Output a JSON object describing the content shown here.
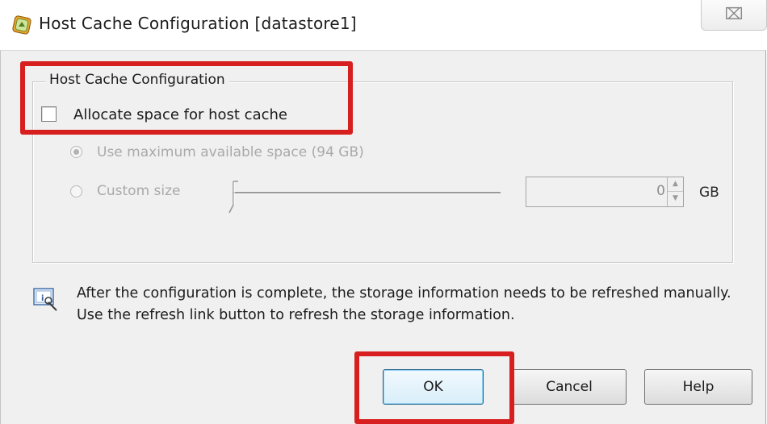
{
  "window": {
    "title": "Host Cache Configuration [datastore1]",
    "close_glyph": "⌧",
    "app_icon": "datastore-config-icon",
    "close_icon": "close-icon"
  },
  "host_cache": {
    "group_title": "Host Cache Configuration",
    "allocate_label": "Allocate space for host cache",
    "allocate_checked": false,
    "options": {
      "max_space_label": "Use maximum available space (94 GB)",
      "max_space_selected": true,
      "custom_size_label": "Custom size",
      "custom_size_selected": false,
      "enabled": false
    },
    "size_slider_value": 0,
    "size_value": "0",
    "size_unit": "GB"
  },
  "info": {
    "icon": "info-refresh-icon",
    "message": "After the configuration is complete, the storage information needs to be refreshed manually. Use the refresh link button to refresh the storage information."
  },
  "buttons": {
    "ok": "OK",
    "cancel": "Cancel",
    "help": "Help"
  },
  "annotations": {
    "highlight_color": "#d81f1f"
  },
  "colors": {
    "panel_background": "#f0f0f0",
    "disabled_text": "#a9a9a9",
    "default_button_border": "#2c628b"
  }
}
